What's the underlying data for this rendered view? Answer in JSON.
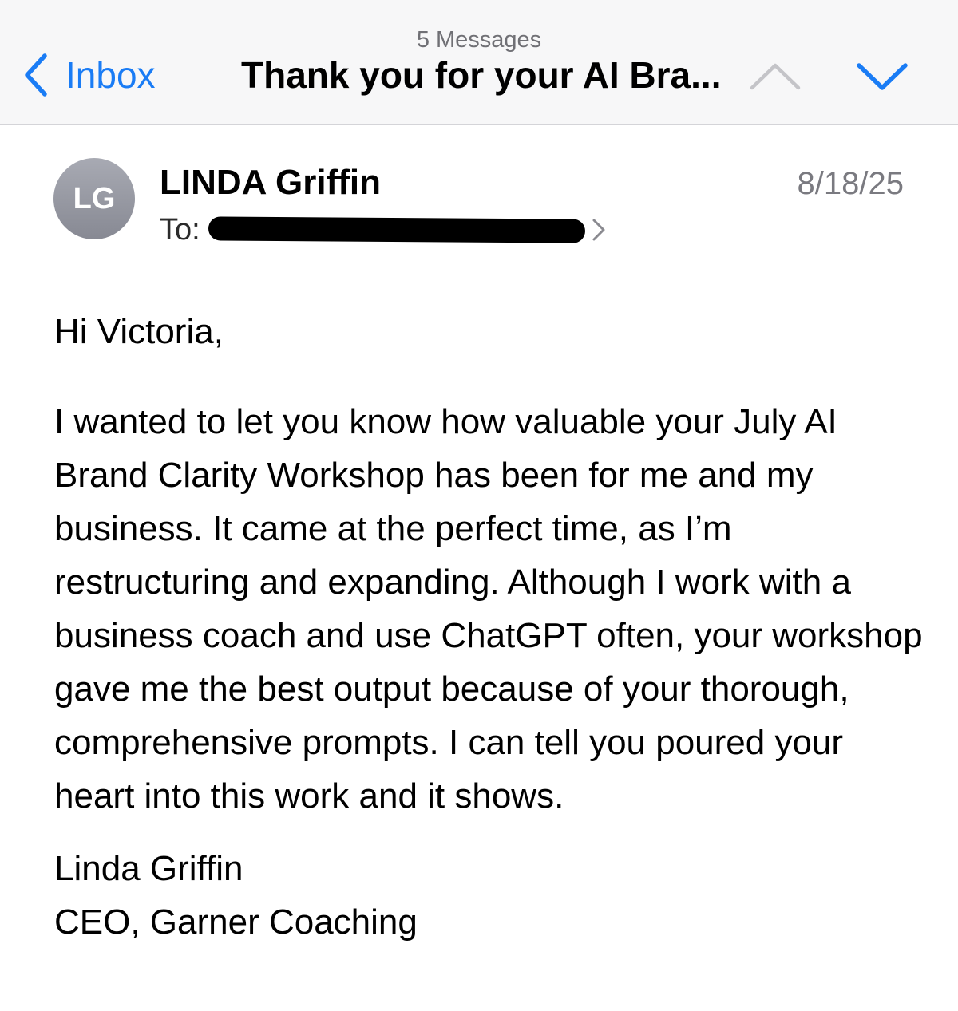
{
  "toolbar": {
    "message_count": "5 Messages",
    "back_label": "Inbox",
    "subject": "Thank you for your AI Bra...",
    "back_icon": "chevron-left-icon",
    "prev_icon": "chevron-up-icon",
    "next_icon": "chevron-down-icon",
    "accent_color": "#1a7cf5"
  },
  "message": {
    "avatar_initials": "LG",
    "sender_name": "LINDA Griffin",
    "date": "8/18/25",
    "to_label": "To:",
    "greeting": "Hi Victoria,",
    "body_text": "I wanted to let you know how valuable your July AI Brand Clarity Workshop has been for me and my business. It came at the perfect time, as I’m restructuring and expanding. Although I work with a business coach and use ChatGPT often, your workshop gave me the best output because of your thorough, comprehensive prompts. I can tell you poured your heart into this work and it shows.",
    "signature_name": "Linda Griffin",
    "signature_title": "CEO, Garner Coaching"
  }
}
